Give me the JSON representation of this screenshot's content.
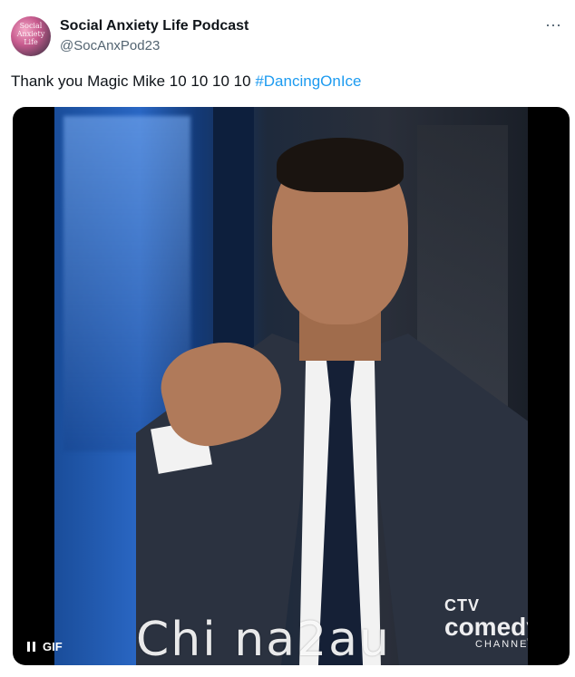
{
  "author": {
    "name": "Social Anxiety Life Podcast",
    "handle": "@SocAnxPod23",
    "avatar_text": "Social Anxiety Life"
  },
  "menu": {
    "more_icon": "⋯"
  },
  "tweet": {
    "text": "Thank you Magic Mike 10 10 10 10 ",
    "hashtag": "#DancingOnIce"
  },
  "media": {
    "control_label": "GIF",
    "logo": {
      "top": "CTV",
      "main": "comedy",
      "sub": "CHANNEL"
    }
  },
  "watermark": "Chi na2au"
}
